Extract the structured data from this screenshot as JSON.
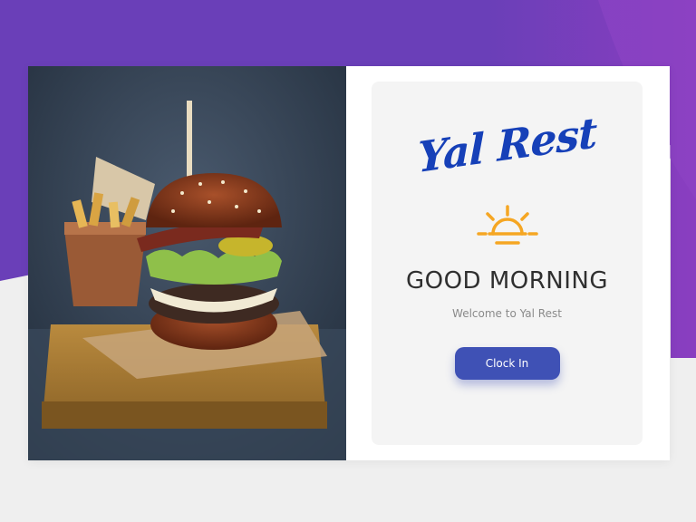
{
  "brand": {
    "name": "Yal Rest"
  },
  "greeting": {
    "title": "GOOD MORNING",
    "subtitle": "Welcome to Yal Rest"
  },
  "actions": {
    "clock_in_label": "Clock In"
  },
  "icons": {
    "sun": "sunrise-icon"
  },
  "colors": {
    "background_purple": "#6a3fb8",
    "brand_blue": "#1640b8",
    "button": "#3f51b5",
    "sun": "#f5a623"
  }
}
